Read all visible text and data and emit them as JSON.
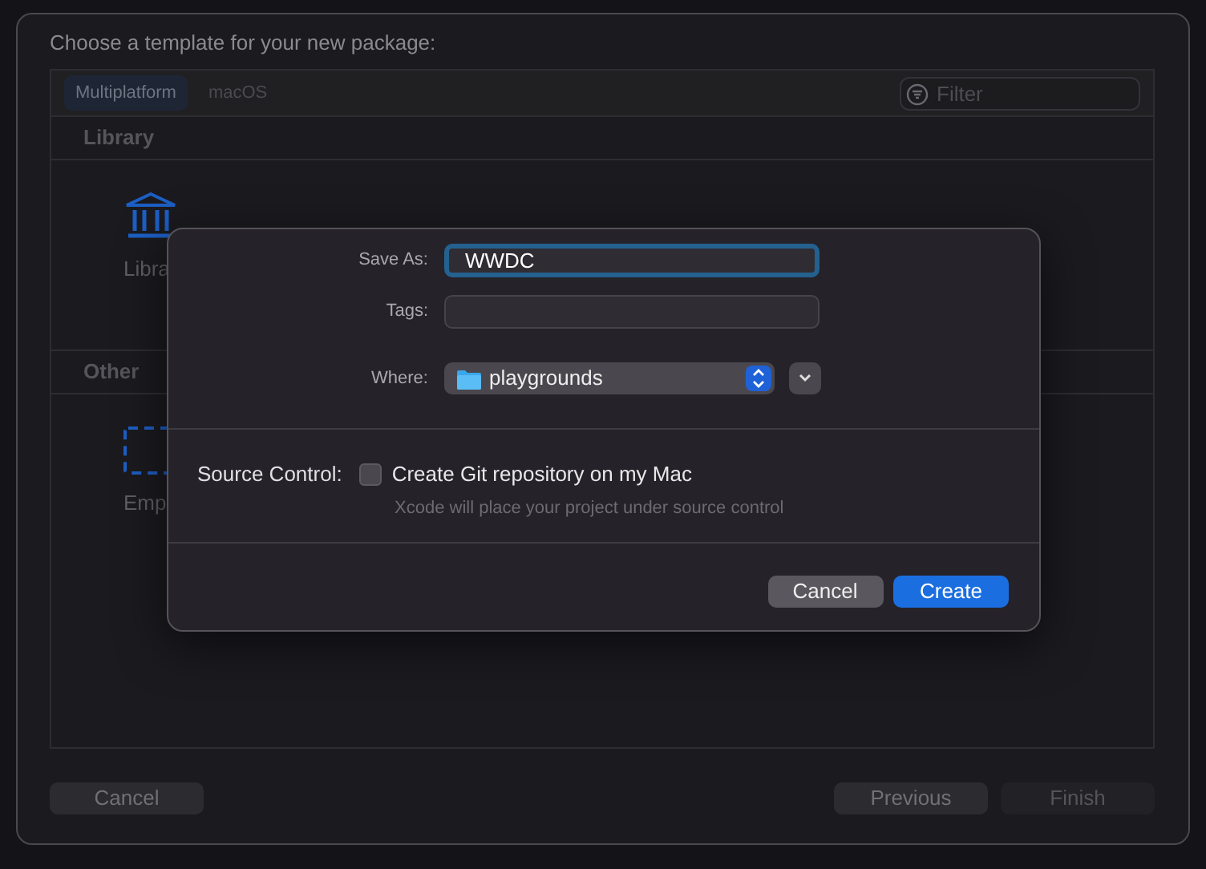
{
  "window": {
    "title": "Choose a template for your new package:"
  },
  "platform_tabs": [
    {
      "label": "Multiplatform",
      "selected": true
    },
    {
      "label": "macOS",
      "selected": false
    }
  ],
  "filter": {
    "placeholder": "Filter"
  },
  "sections": [
    {
      "title": "Library",
      "templates": [
        {
          "label": "Libra",
          "kind": "library"
        }
      ]
    },
    {
      "title": "Other",
      "templates": [
        {
          "label": "Emp",
          "kind": "empty"
        }
      ]
    }
  ],
  "buttons": [
    {
      "label": "Cancel",
      "disabled": false
    },
    {
      "label": "Previous",
      "disabled": false
    },
    {
      "label": "Finish",
      "disabled": true
    }
  ],
  "save_sheet": {
    "save_as": {
      "label": "Save As:",
      "value": "WWDC",
      "focused": true
    },
    "tags": {
      "label": "Tags:"
    },
    "where": {
      "label": "Where:",
      "value": "playgrounds"
    },
    "source_control": {
      "label": "Source Control:",
      "option": "Create Git repository on my Mac",
      "checked": false,
      "note": "Xcode will place your project under source control"
    },
    "buttons": [
      {
        "label": "Cancel",
        "kind": "cancel"
      },
      {
        "label": "Create",
        "kind": "default"
      }
    ]
  }
}
